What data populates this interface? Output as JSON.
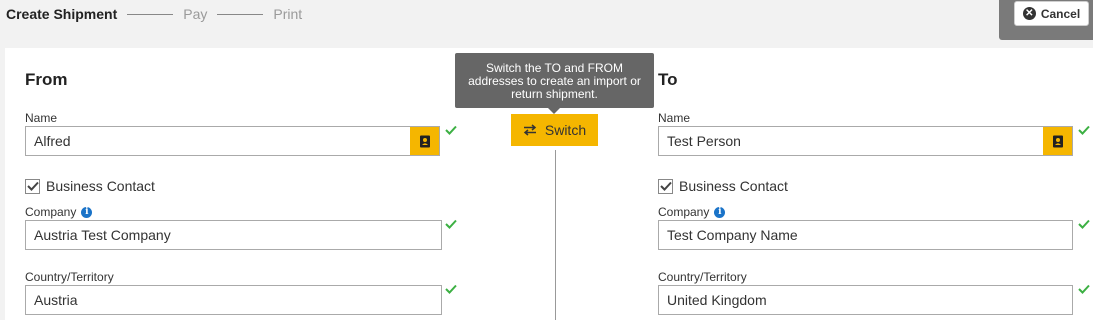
{
  "steps": {
    "current": "Create Shipment",
    "pay": "Pay",
    "print": "Print"
  },
  "cancel": {
    "label": "Cancel"
  },
  "tooltip": {
    "text": "Switch the TO and FROM addresses to create an import or return shipment."
  },
  "switch": {
    "label": "Switch"
  },
  "from": {
    "title": "From",
    "name_label": "Name",
    "name_value": "Alfred",
    "business_contact_label": "Business Contact",
    "business_contact_checked": true,
    "company_label": "Company",
    "company_value": "Austria Test Company",
    "country_label": "Country/Territory",
    "country_value": "Austria"
  },
  "to": {
    "title": "To",
    "name_label": "Name",
    "name_value": "Test Person",
    "business_contact_label": "Business Contact",
    "business_contact_checked": true,
    "company_label": "Company",
    "company_value": "Test Company Name",
    "country_label": "Country/Territory",
    "country_value": "United Kingdom"
  },
  "colors": {
    "accent": "#f5b600",
    "valid_check": "#3cb043",
    "info": "#1a73c8"
  },
  "icons": {
    "contact_book": "contact-book-icon",
    "valid": "checkmark-icon",
    "info": "info-icon",
    "switch": "swap-arrows-icon",
    "cancel": "close-circle-icon"
  }
}
